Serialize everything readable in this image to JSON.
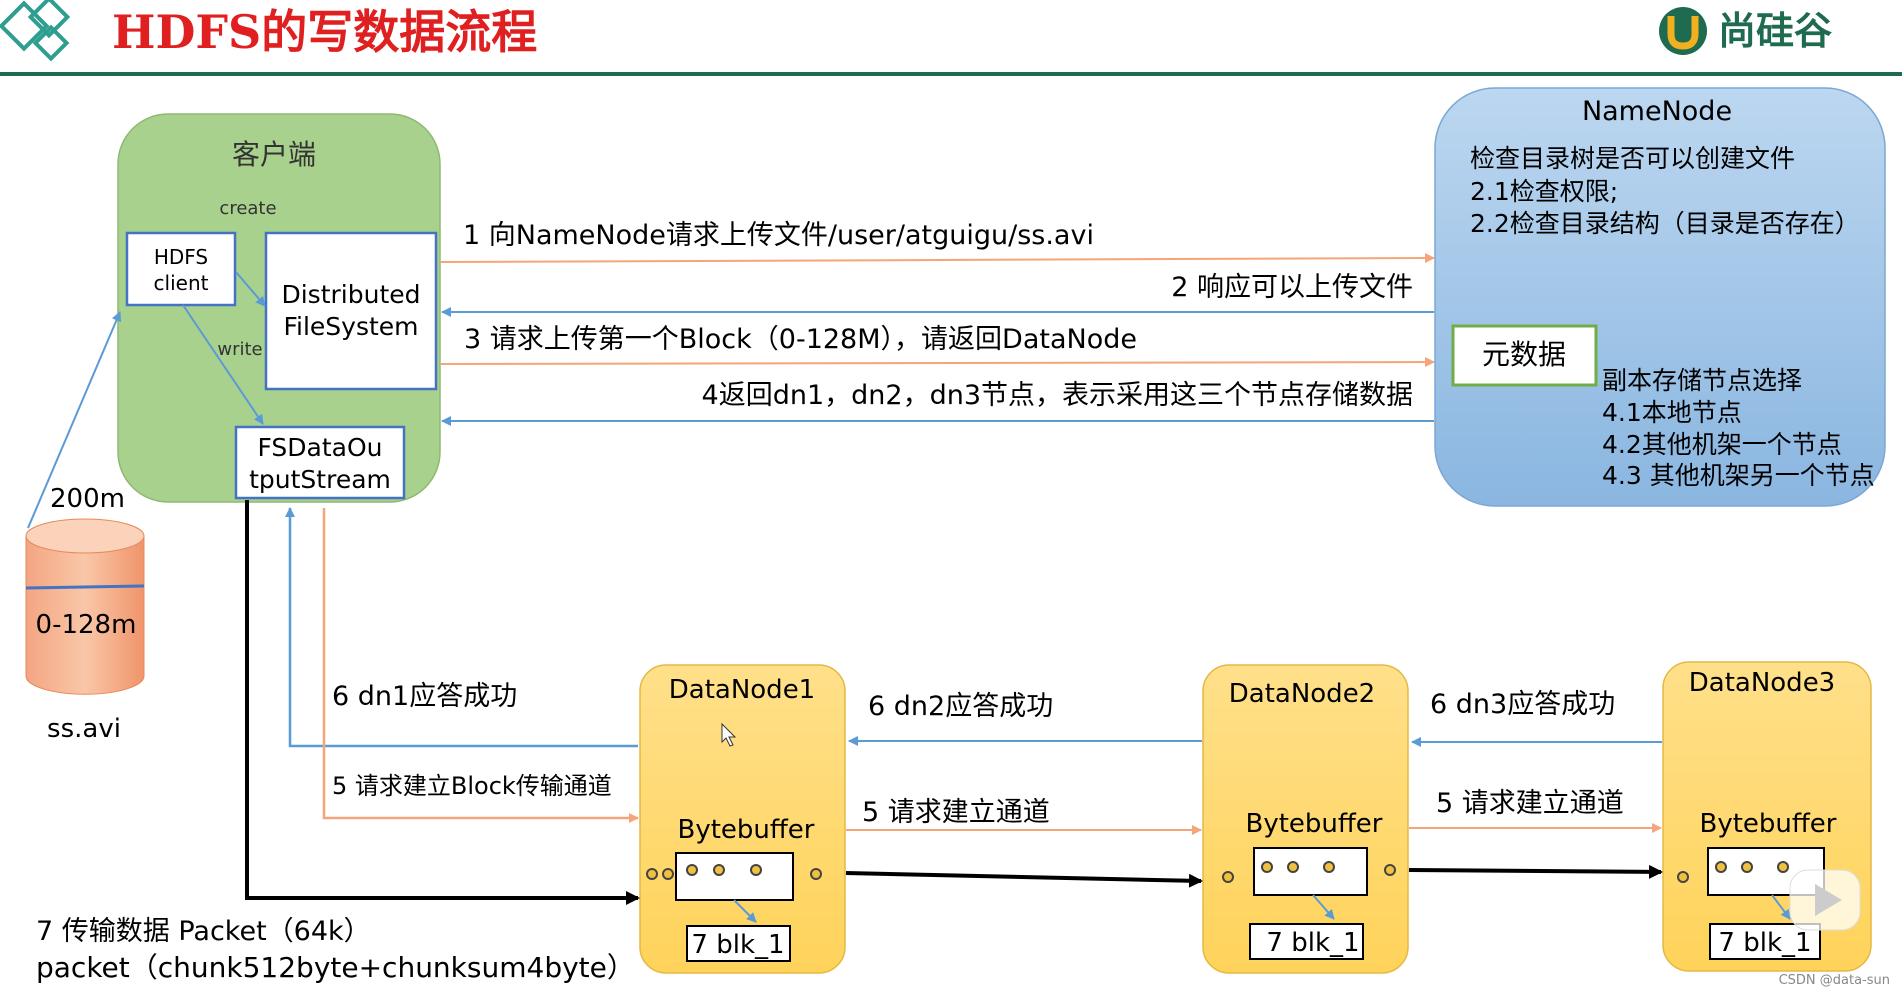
{
  "header": {
    "title": "HDFS的写数据流程",
    "brand": "尚硅谷"
  },
  "client": {
    "label": "客户端",
    "hdfs_client": [
      "HDFS",
      "client"
    ],
    "create_label": "create",
    "write_label": "write",
    "dfs_box": [
      "Distributed",
      "FileSystem"
    ],
    "fsdos_box": [
      "FSDataOu",
      "tputStream"
    ]
  },
  "file": {
    "size_label": "200m",
    "block_label": "0-128m",
    "name": "ss.avi"
  },
  "namenode": {
    "title": "NameNode",
    "checks": [
      "检查目录树是否可以创建文件",
      "2.1检查权限;",
      "2.2检查目录结构（目录是否存在）"
    ],
    "metadata_label": "元数据",
    "replica_notes": [
      "副本存储节点选择",
      "4.1本地节点",
      "4.2其他机架一个节点",
      "4.3 其他机架另一个节点"
    ]
  },
  "steps": {
    "s1": "1 向NameNode请求上传文件/user/atguigu/ss.avi",
    "s2": "2 响应可以上传文件",
    "s3": "3 请求上传第一个Block（0-128M），请返回DataNode",
    "s4": "4返回dn1，dn2，dn3节点，表示采用这三个节点存储数据",
    "s5a": "5 请求建立Block传输通道",
    "s5b": "5 请求建立通道",
    "s5c": "5 请求建立通道",
    "s6a": "6 dn1应答成功",
    "s6b": "6 dn2应答成功",
    "s6c": "6 dn3应答成功",
    "s7": "7 传输数据  Packet（64k）",
    "packet": "packet（chunk512byte+chunksum4byte）"
  },
  "datanodes": [
    {
      "name": "DataNode1",
      "buffer": "Bytebuffer",
      "block": "7 blk_1"
    },
    {
      "name": "DataNode2",
      "buffer": "Bytebuffer",
      "block": "7 blk_1"
    },
    {
      "name": "DataNode3",
      "buffer": "Bytebuffer",
      "block": "7 blk_1"
    }
  ],
  "watermark": "CSDN @data-sun",
  "colors": {
    "title_red": "#e02020",
    "header_line": "#1f6b4f",
    "client_green": "#a9d18e",
    "namenode_blue": "#9dc3e6",
    "datanode_yellow": "#ffd966",
    "arrow_orange": "#f4a67a",
    "arrow_blue": "#5b9bd5",
    "arrow_black": "#000000"
  }
}
